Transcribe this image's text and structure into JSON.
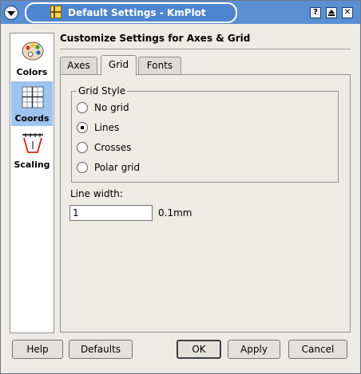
{
  "window": {
    "title": "Default Settings - KmPlot"
  },
  "titlebar_buttons": {
    "help": "?",
    "close": "✕"
  },
  "sidebar": {
    "items": [
      {
        "label": "Colors",
        "icon": "palette-icon",
        "selected": false
      },
      {
        "label": "Coords",
        "icon": "coordinate-grid-icon",
        "selected": true
      },
      {
        "label": "Scaling",
        "icon": "scaling-icon",
        "selected": false
      }
    ]
  },
  "page": {
    "heading": "Customize Settings for Axes & Grid",
    "tabs": [
      {
        "label": "Axes",
        "active": false
      },
      {
        "label": "Grid",
        "active": true
      },
      {
        "label": "Fonts",
        "active": false
      }
    ]
  },
  "grid_style": {
    "title": "Grid Style",
    "options": [
      {
        "label": "No grid",
        "checked": false
      },
      {
        "label": "Lines",
        "checked": true
      },
      {
        "label": "Crosses",
        "checked": false
      },
      {
        "label": "Polar grid",
        "checked": false
      }
    ]
  },
  "line_width": {
    "label": "Line width:",
    "value": "1",
    "unit": "0.1mm"
  },
  "buttons": {
    "help": "Help",
    "defaults": "Defaults",
    "ok": "OK",
    "apply": "Apply",
    "cancel": "Cancel"
  },
  "colors": {
    "titlebar": "#5a8fd4",
    "selection": "#9ec4ef",
    "dialog_bg": "#eeebe7"
  }
}
